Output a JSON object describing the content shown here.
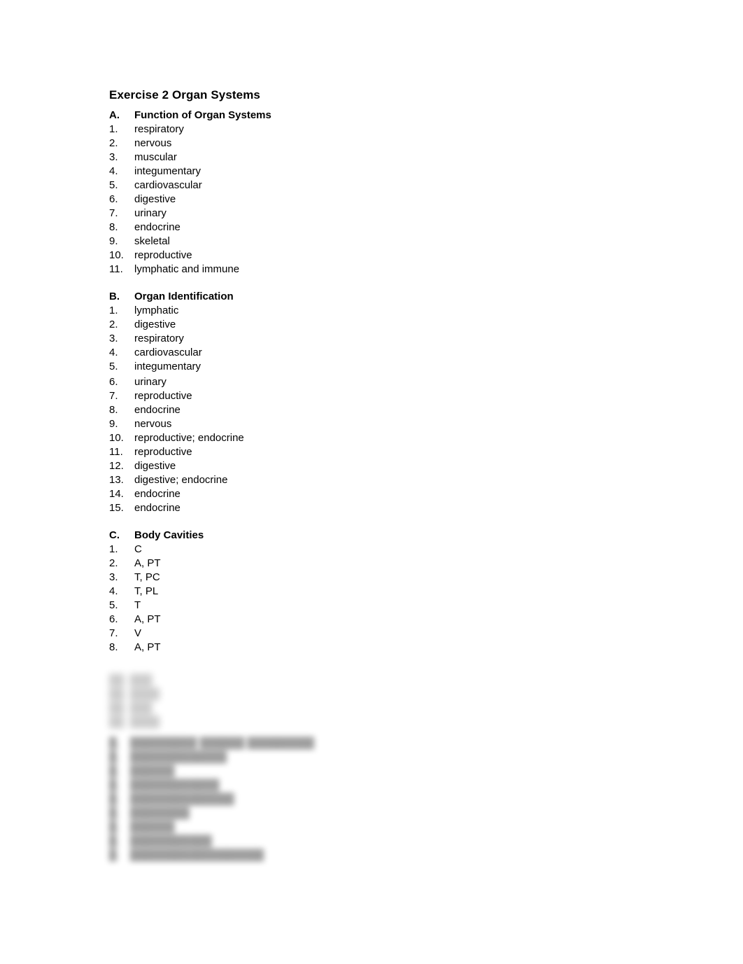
{
  "document": {
    "title": "Exercise 2 Organ Systems"
  },
  "sections": [
    {
      "marker": "A.",
      "heading": "Function of Organ Systems",
      "items": [
        {
          "marker": "1.",
          "answer": "respiratory"
        },
        {
          "marker": "2.",
          "answer": "nervous"
        },
        {
          "marker": "3.",
          "answer": "muscular"
        },
        {
          "marker": "4.",
          "answer": "integumentary"
        },
        {
          "marker": "5.",
          "answer": "cardiovascular"
        },
        {
          "marker": "6.",
          "answer": "digestive"
        },
        {
          "marker": "7.",
          "answer": "urinary"
        },
        {
          "marker": "8.",
          "answer": "endocrine"
        },
        {
          "marker": "9.",
          "answer": "skeletal"
        },
        {
          "marker": "10.",
          "answer": "reproductive"
        },
        {
          "marker": "11.",
          "answer": "lymphatic and immune"
        }
      ]
    },
    {
      "marker": "B.",
      "heading": "Organ Identification",
      "items": [
        {
          "marker": "1.",
          "answer": "lymphatic"
        },
        {
          "marker": "2.",
          "answer": "digestive"
        },
        {
          "marker": "3.",
          "answer": "respiratory"
        },
        {
          "marker": "4.",
          "answer": "cardiovascular"
        },
        {
          "marker": "5.",
          "answer": "integumentary"
        },
        {
          "marker": "6.",
          "answer": "urinary"
        },
        {
          "marker": "7.",
          "answer": "reproductive"
        },
        {
          "marker": "8.",
          "answer": "endocrine"
        },
        {
          "marker": "9.",
          "answer": "nervous"
        },
        {
          "marker": "10.",
          "answer": "reproductive; endocrine"
        },
        {
          "marker": "11.",
          "answer": "reproductive"
        },
        {
          "marker": "12.",
          "answer": "digestive"
        },
        {
          "marker": "13.",
          "answer": "digestive; endocrine"
        },
        {
          "marker": "14.",
          "answer": "endocrine"
        },
        {
          "marker": "15.",
          "answer": "endocrine"
        }
      ]
    },
    {
      "marker": "C.",
      "heading": "Body Cavities",
      "items": [
        {
          "marker": "1.",
          "answer": "C"
        },
        {
          "marker": "2.",
          "answer": "A, PT"
        },
        {
          "marker": "3.",
          "answer": "T, PC"
        },
        {
          "marker": "4.",
          "answer": "T, PL"
        },
        {
          "marker": "5.",
          "answer": "T"
        },
        {
          "marker": "6.",
          "answer": "A, PT"
        },
        {
          "marker": "7.",
          "answer": "V"
        },
        {
          "marker": "8.",
          "answer": "A, PT"
        }
      ]
    }
  ],
  "obscured": {
    "note": "blurred",
    "block_one_lines": [
      "██.  ███",
      "██.  ████",
      "██.  ███",
      "██.  ████"
    ],
    "block_two_heading": "█. █████████  ██████  █████████",
    "block_two_lines": [
      "█. █████████████",
      "█. ██████",
      "█. ████████████",
      "█. ██████████████",
      "█. ████████",
      "█. ██████",
      "█. ███████████",
      "█. ██████████████████"
    ]
  }
}
